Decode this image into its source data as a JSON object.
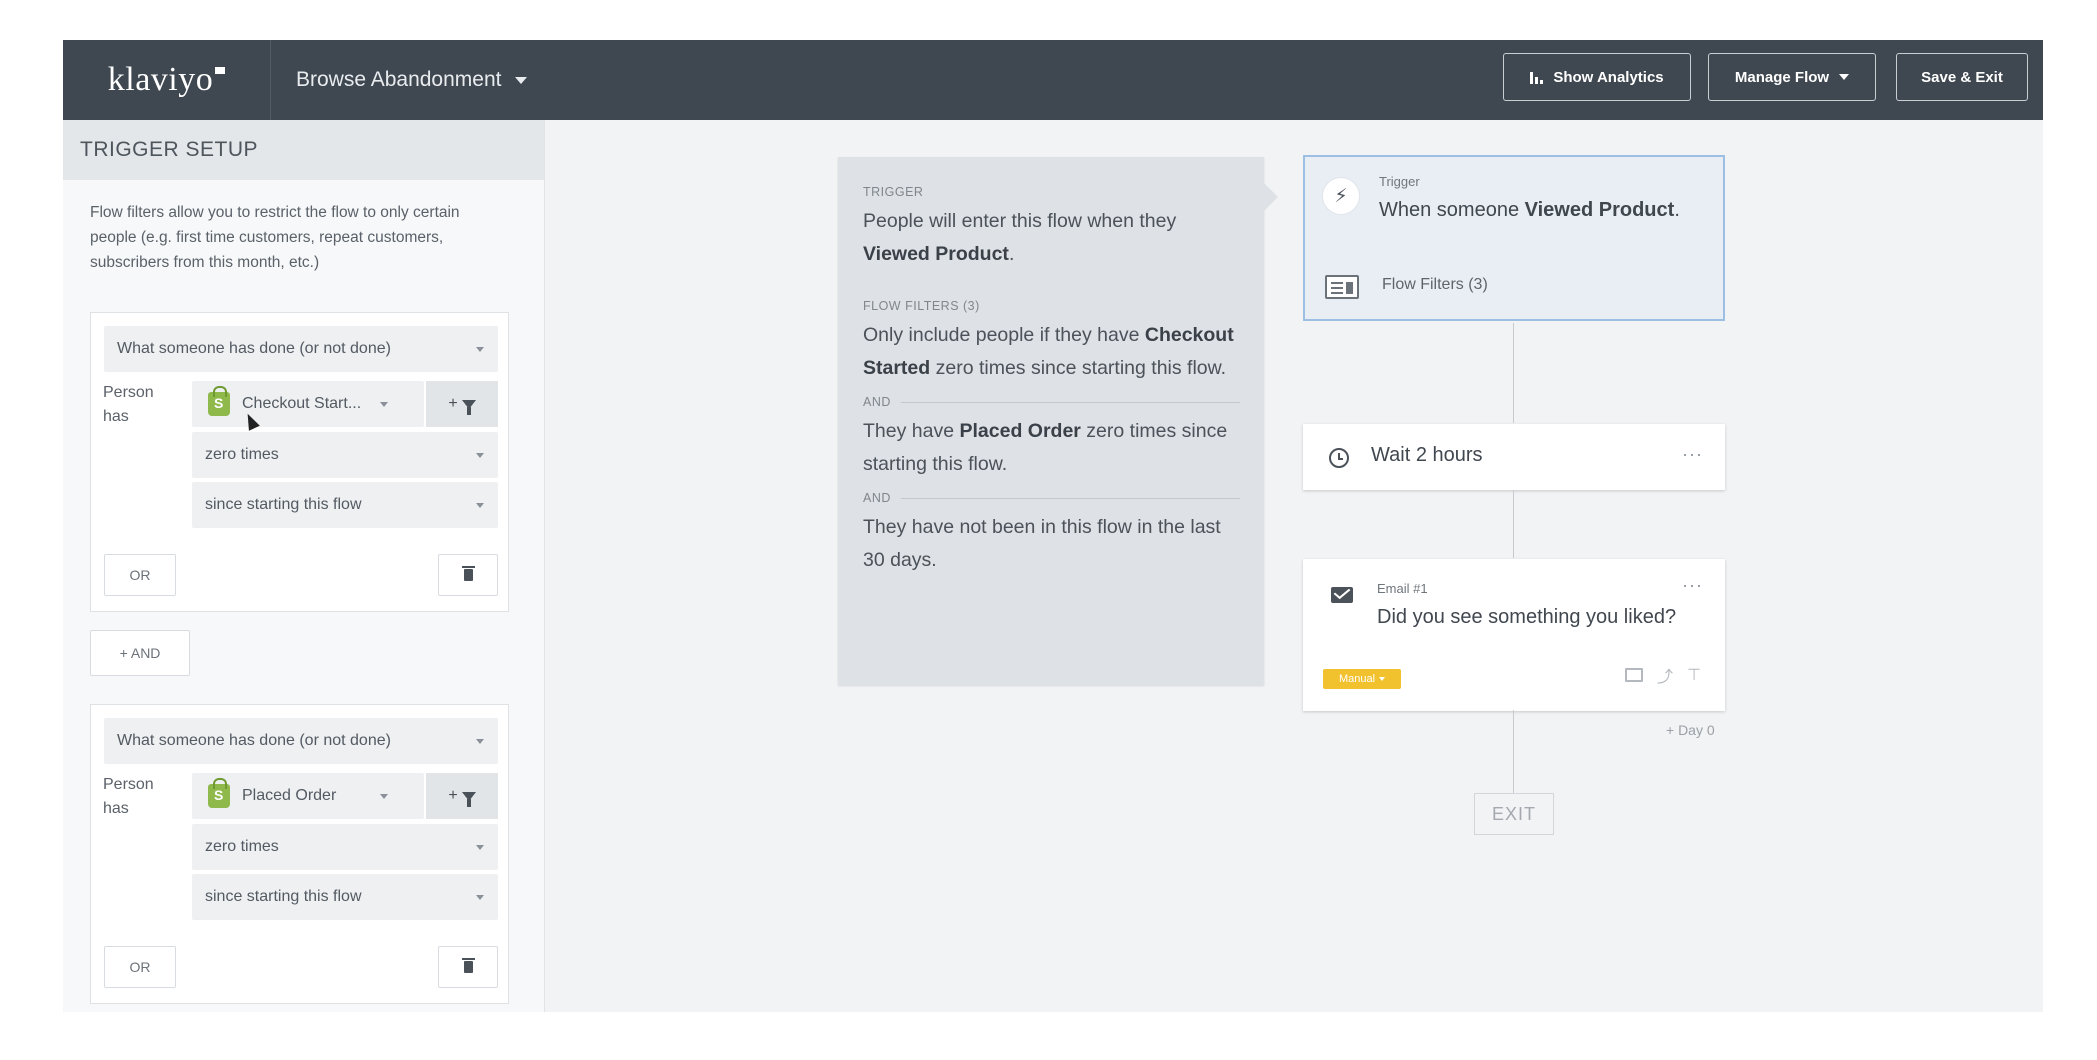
{
  "app": {
    "logo": "klaviyo",
    "flow_name": "Browse Abandonment"
  },
  "toolbar": {
    "analytics_label": "Show Analytics",
    "manage_label": "Manage Flow",
    "save_label": "Save & Exit"
  },
  "panel": {
    "header": "TRIGGER SETUP",
    "description": "Flow filters allow you to restrict the flow to only certain people (e.g. first time customers, repeat customers, subscribers from this month, etc.)",
    "and_label": "+ AND",
    "filters": [
      {
        "condition": "What someone has done (or not done)",
        "person_label_1": "Person",
        "person_label_2": "has",
        "metric": "Checkout Start...",
        "funnel_label": "+",
        "frequency": "zero times",
        "timeframe": "since starting this flow",
        "or_label": "OR"
      },
      {
        "condition": "What someone has done (or not done)",
        "person_label_1": "Person",
        "person_label_2": "has",
        "metric": "Placed Order",
        "funnel_label": "+",
        "frequency": "zero times",
        "timeframe": "since starting this flow",
        "or_label": "OR"
      }
    ]
  },
  "info": {
    "trigger_label": "TRIGGER",
    "trigger_text_pre": "People will enter this flow when they",
    "trigger_metric": "Viewed Product",
    "trigger_text_post": ".",
    "filters_label": "FLOW FILTERS (3)",
    "filter1_pre": "Only include people if they have",
    "filter1_metric": "Checkout Started",
    "filter1_post": "zero times since starting this flow.",
    "and_label_1": "AND",
    "filter2_pre": "They have",
    "filter2_metric": "Placed Order",
    "filter2_post": "zero times since starting this flow.",
    "and_label_2": "AND",
    "filter3": "They have not been in this flow in the last 30 days."
  },
  "flow": {
    "trigger": {
      "label": "Trigger",
      "text_pre": "When someone",
      "metric": "Viewed Product",
      "text_post": ".",
      "filters_text": "Flow Filters (3)"
    },
    "wait": {
      "text": "Wait 2 hours"
    },
    "email": {
      "label": "Email #1",
      "subject": "Did you see something you liked?",
      "badge": "Manual",
      "day": "+ Day 0"
    },
    "exit": "EXIT",
    "menu_dots": "···"
  },
  "colors": {
    "topbar": "#3f4850",
    "trigger_border": "#9dbfe3",
    "manual_badge": "#f2c12e",
    "shopify_green": "#8fb94b"
  }
}
